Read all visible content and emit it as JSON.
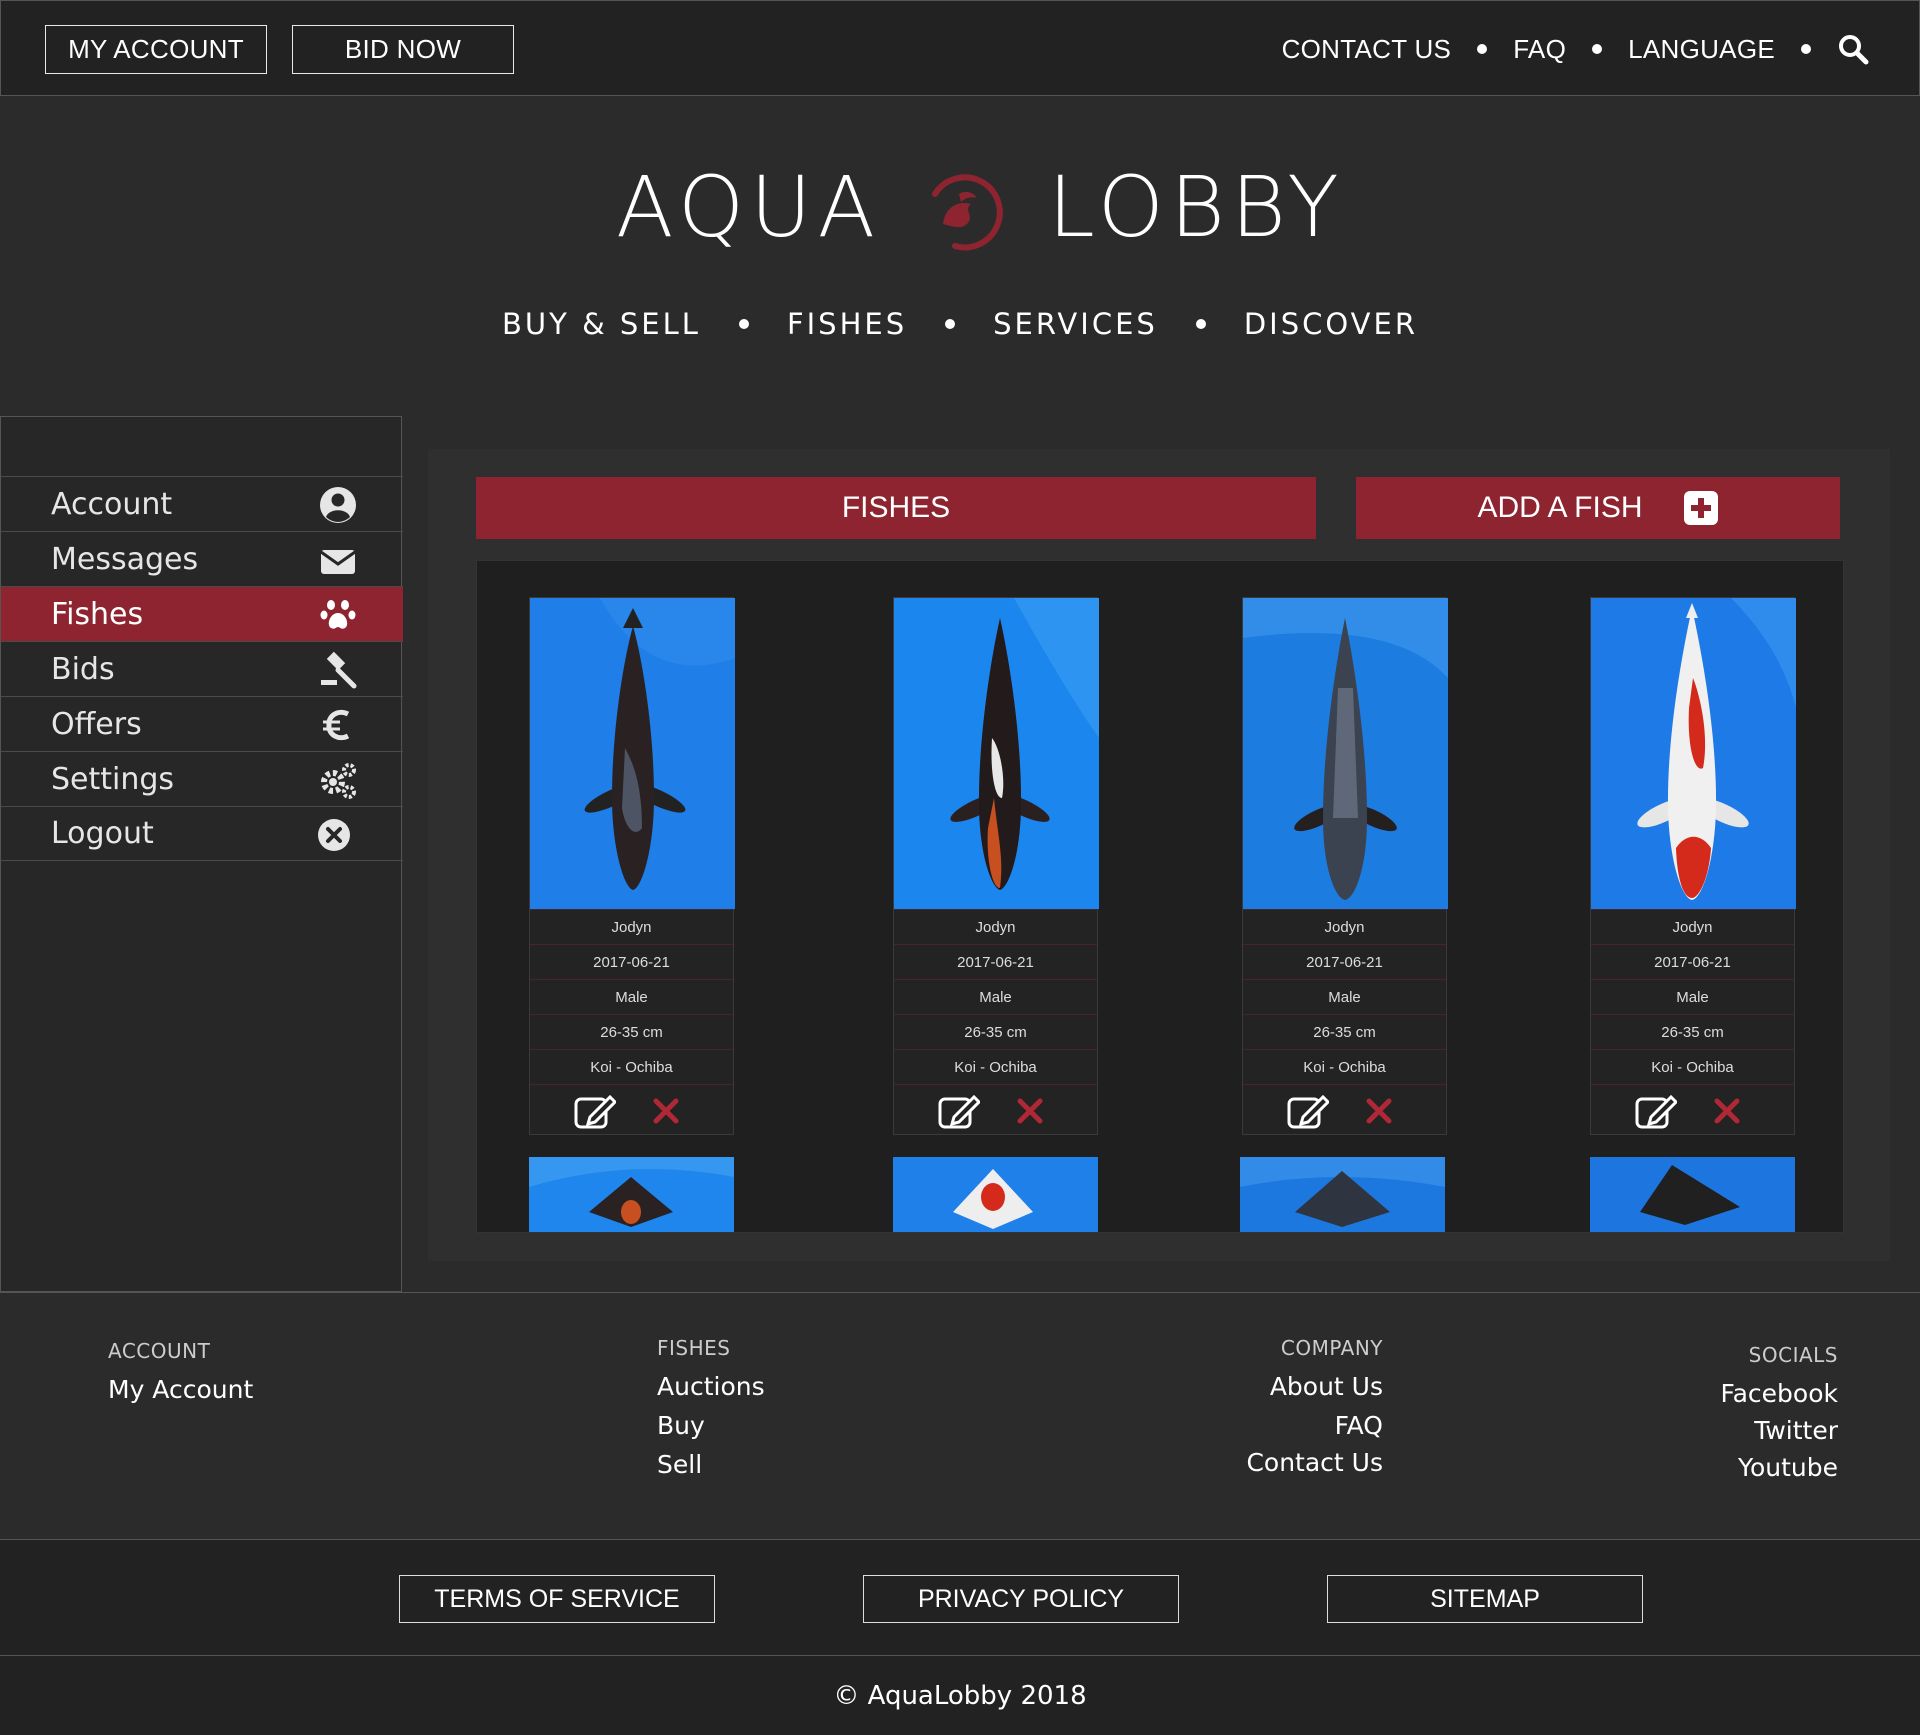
{
  "topbar": {
    "my_account": "MY ACCOUNT",
    "bid_now": "BID NOW",
    "links": [
      "CONTACT US",
      "FAQ",
      "LANGUAGE"
    ],
    "search_icon": "search-icon"
  },
  "brand": {
    "word1": "AQUA",
    "word2": "LOBBY",
    "logo_color": "#8e2430"
  },
  "mainnav": [
    "BUY & SELL",
    "FISHES",
    "SERVICES",
    "DISCOVER"
  ],
  "sidebar": {
    "items": [
      {
        "label": "Account",
        "icon": "user-circle-icon"
      },
      {
        "label": "Messages",
        "icon": "envelope-icon"
      },
      {
        "label": "Fishes",
        "icon": "paw-icon",
        "active": true
      },
      {
        "label": "Bids",
        "icon": "gavel-icon"
      },
      {
        "label": "Offers",
        "icon": "euro-icon"
      },
      {
        "label": "Settings",
        "icon": "gears-icon"
      },
      {
        "label": "Logout",
        "icon": "close-circle-icon"
      }
    ]
  },
  "main": {
    "fishes_label": "FISHES",
    "add_label": "ADD A FISH",
    "accent": "#8e2430",
    "cards": [
      {
        "owner": "Jodyn",
        "date": "2017-06-21",
        "sex": "Male",
        "size": "26-35 cm",
        "variety": "Koi - Ochiba"
      },
      {
        "owner": "Jodyn",
        "date": "2017-06-21",
        "sex": "Male",
        "size": "26-35 cm",
        "variety": "Koi - Ochiba"
      },
      {
        "owner": "Jodyn",
        "date": "2017-06-21",
        "sex": "Male",
        "size": "26-35 cm",
        "variety": "Koi - Ochiba"
      },
      {
        "owner": "Jodyn",
        "date": "2017-06-21",
        "sex": "Male",
        "size": "26-35 cm",
        "variety": "Koi - Ochiba"
      }
    ]
  },
  "footer": {
    "account": {
      "head": "ACCOUNT",
      "links": [
        "My Account"
      ]
    },
    "fishes": {
      "head": "FISHES",
      "links": [
        "Auctions",
        "Buy",
        "Sell"
      ]
    },
    "company": {
      "head": "COMPANY",
      "links": [
        "About Us",
        "FAQ",
        "Contact Us"
      ]
    },
    "socials": {
      "head": "SOCIALS",
      "links": [
        "Facebook",
        "Twitter",
        "Youtube"
      ]
    }
  },
  "bottom": {
    "terms": "TERMS OF SERVICE",
    "privacy": "PRIVACY POLICY",
    "sitemap": "SITEMAP",
    "copyright": "© AquaLobby 2018"
  }
}
